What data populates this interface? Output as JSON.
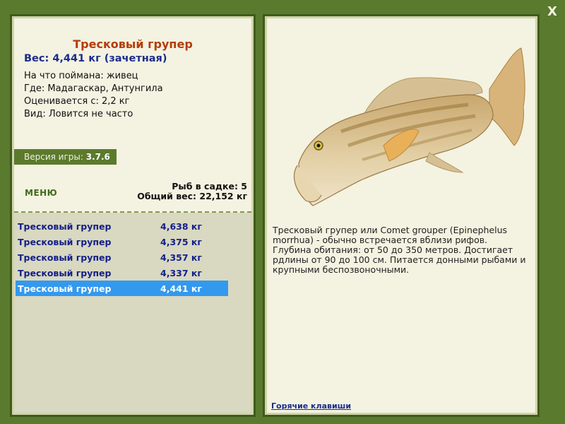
{
  "fish": {
    "name": "Тресковый групер",
    "weight_line": "Вес: 4,441 кг (зачетная)",
    "caught_with": "На что поймана: живец",
    "where": "Где: Мадагаскар, Антунгила",
    "valued_from": "Оценивается с: 2,2 кг",
    "kind": "Вид: Ловится не часто"
  },
  "version": {
    "label": "Версия игры:",
    "value": "3.7.6"
  },
  "menu_label": "МЕНЮ",
  "cage": {
    "count_line": "Рыб в садке: 5",
    "total_line": "Общий вес: 22,152 кг"
  },
  "catch_list": [
    {
      "name": "Тресковый групер",
      "weight": "4,638 кг",
      "selected": false
    },
    {
      "name": "Тресковый групер",
      "weight": "4,375 кг",
      "selected": false
    },
    {
      "name": "Тресковый групер",
      "weight": "4,357 кг",
      "selected": false
    },
    {
      "name": "Тресковый групер",
      "weight": "4,337 кг",
      "selected": false
    },
    {
      "name": "Тресковый групер",
      "weight": "4,441 кг",
      "selected": true
    }
  ],
  "description": "Тресковый групер или Comet grouper (Epinephelus morrhua) - обычно встречается вблизи рифов. Глубина обитания: от 50 до 350 метров. Достигает рдлины от 90 до 100 см. Питается донными рыбами и крупными беспозвоночными.",
  "hotkeys_label": "Горячие клавиши",
  "close_label": "X",
  "colors": {
    "background": "#5a7a2e",
    "panel": "#f4f2e1",
    "title": "#b43c08",
    "accent_text": "#1a2d8c",
    "selected_row": "#3399ee"
  }
}
